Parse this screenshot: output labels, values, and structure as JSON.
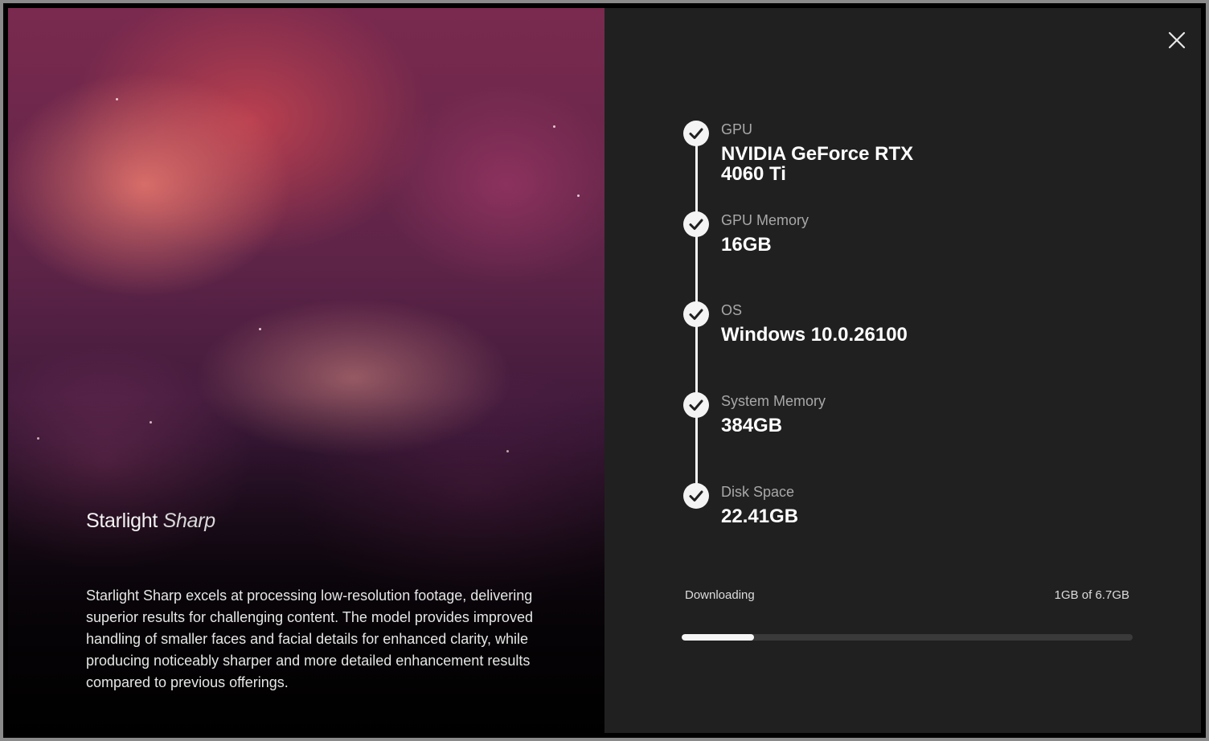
{
  "hero": {
    "brand_name": "Starlight",
    "brand_style": "Sharp",
    "description": "Starlight Sharp excels at processing low-resolution footage, delivering superior results for challenging content. The model provides improved handling of smaller faces and facial details for enhanced clarity, while producing noticeably sharper and more detailed enhancement results compared to previous offerings."
  },
  "requirements": [
    {
      "label": "GPU",
      "value": "NVIDIA GeForce RTX 4060 Ti",
      "status": "passed"
    },
    {
      "label": "GPU Memory",
      "value": "16GB",
      "status": "passed"
    },
    {
      "label": "OS",
      "value": "Windows 10.0.26100",
      "status": "passed"
    },
    {
      "label": "System Memory",
      "value": "384GB",
      "status": "passed"
    },
    {
      "label": "Disk Space",
      "value": "22.41GB",
      "status": "passed"
    }
  ],
  "download": {
    "status": "Downloading",
    "size_text": "1GB of 6.7GB",
    "progress_fraction": 0.16
  },
  "icons": {
    "close": "close-icon",
    "check": "checkmark-icon"
  },
  "colors": {
    "panel_background": "#202020",
    "accent": "#f4f4f4",
    "progress_track": "#3a3a3a",
    "label_muted": "#a8a8a8"
  }
}
